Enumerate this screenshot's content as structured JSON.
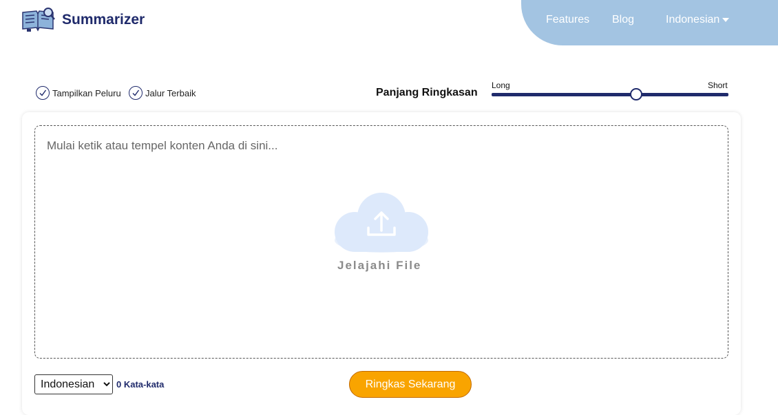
{
  "header": {
    "brand": "Summarizer",
    "nav": {
      "features": "Features",
      "blog": "Blog",
      "language": "Indonesian"
    },
    "nav_bg_color": "#a3c4e2"
  },
  "options": {
    "show_bullets": "Tampilkan Peluru",
    "best_line": "Jalur Terbaik"
  },
  "summary_length": {
    "label": "Panjang Ringkasan",
    "min_label": "Long",
    "max_label": "Short",
    "value_fraction": 0.61
  },
  "editor": {
    "placeholder": "Mulai ketik atau tempel konten Anda di sini...",
    "browse_label": "Jelajahi File"
  },
  "footer": {
    "language_selected": "Indonesian",
    "word_count": "0 Kata-kata",
    "summarize_button": "Ringkas Sekarang"
  },
  "colors": {
    "brand": "#1f2a6b",
    "accent": "#f9a400",
    "cloud": "#dde9fb"
  },
  "icons": {
    "logo": "book-magnifier-icon",
    "check": "check-circle-icon",
    "upload": "cloud-upload-icon",
    "dropdown": "chevron-down-icon"
  }
}
